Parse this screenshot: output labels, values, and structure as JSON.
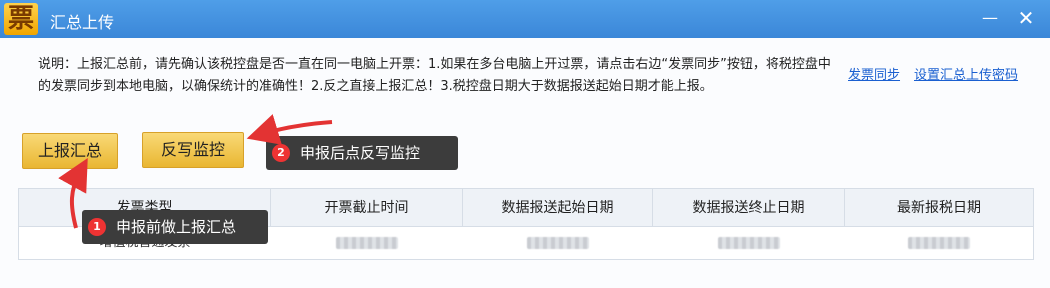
{
  "window": {
    "title": "汇总上传",
    "app_icon_glyph": "票",
    "minimize_glyph": "—",
    "close_glyph": "✕"
  },
  "description": "说明：上报汇总前，请先确认该税控盘是否一直在同一电脑上开票：1.如果在多台电脑上开过票，请点击右边“发票同步”按钮，将税控盘中的发票同步到本地电脑，以确保统计的准确性！2.反之直接上报汇总！3.税控盘日期大于数据报送起始日期才能上报。",
  "links": {
    "invoice_sync": "发票同步",
    "set_password": "设置汇总上传密码"
  },
  "buttons": {
    "report_summary": "上报汇总",
    "write_back": "反写监控"
  },
  "tips": {
    "tip1_num": "1",
    "tip1_text": "申报前做上报汇总",
    "tip2_num": "2",
    "tip2_text": "申报后点反写监控"
  },
  "table": {
    "headers": [
      "发票类型",
      "开票截止时间",
      "数据报送起始日期",
      "数据报送终止日期",
      "最新报税日期"
    ],
    "rows": [
      {
        "invoice_type": "增值税普通发票"
      }
    ]
  },
  "colors": {
    "titlebar": "#3b87d8",
    "button": "#e9b632",
    "arrow": "#e33333",
    "tooltip": "#3c3c3c",
    "link": "#1a5fd0"
  }
}
